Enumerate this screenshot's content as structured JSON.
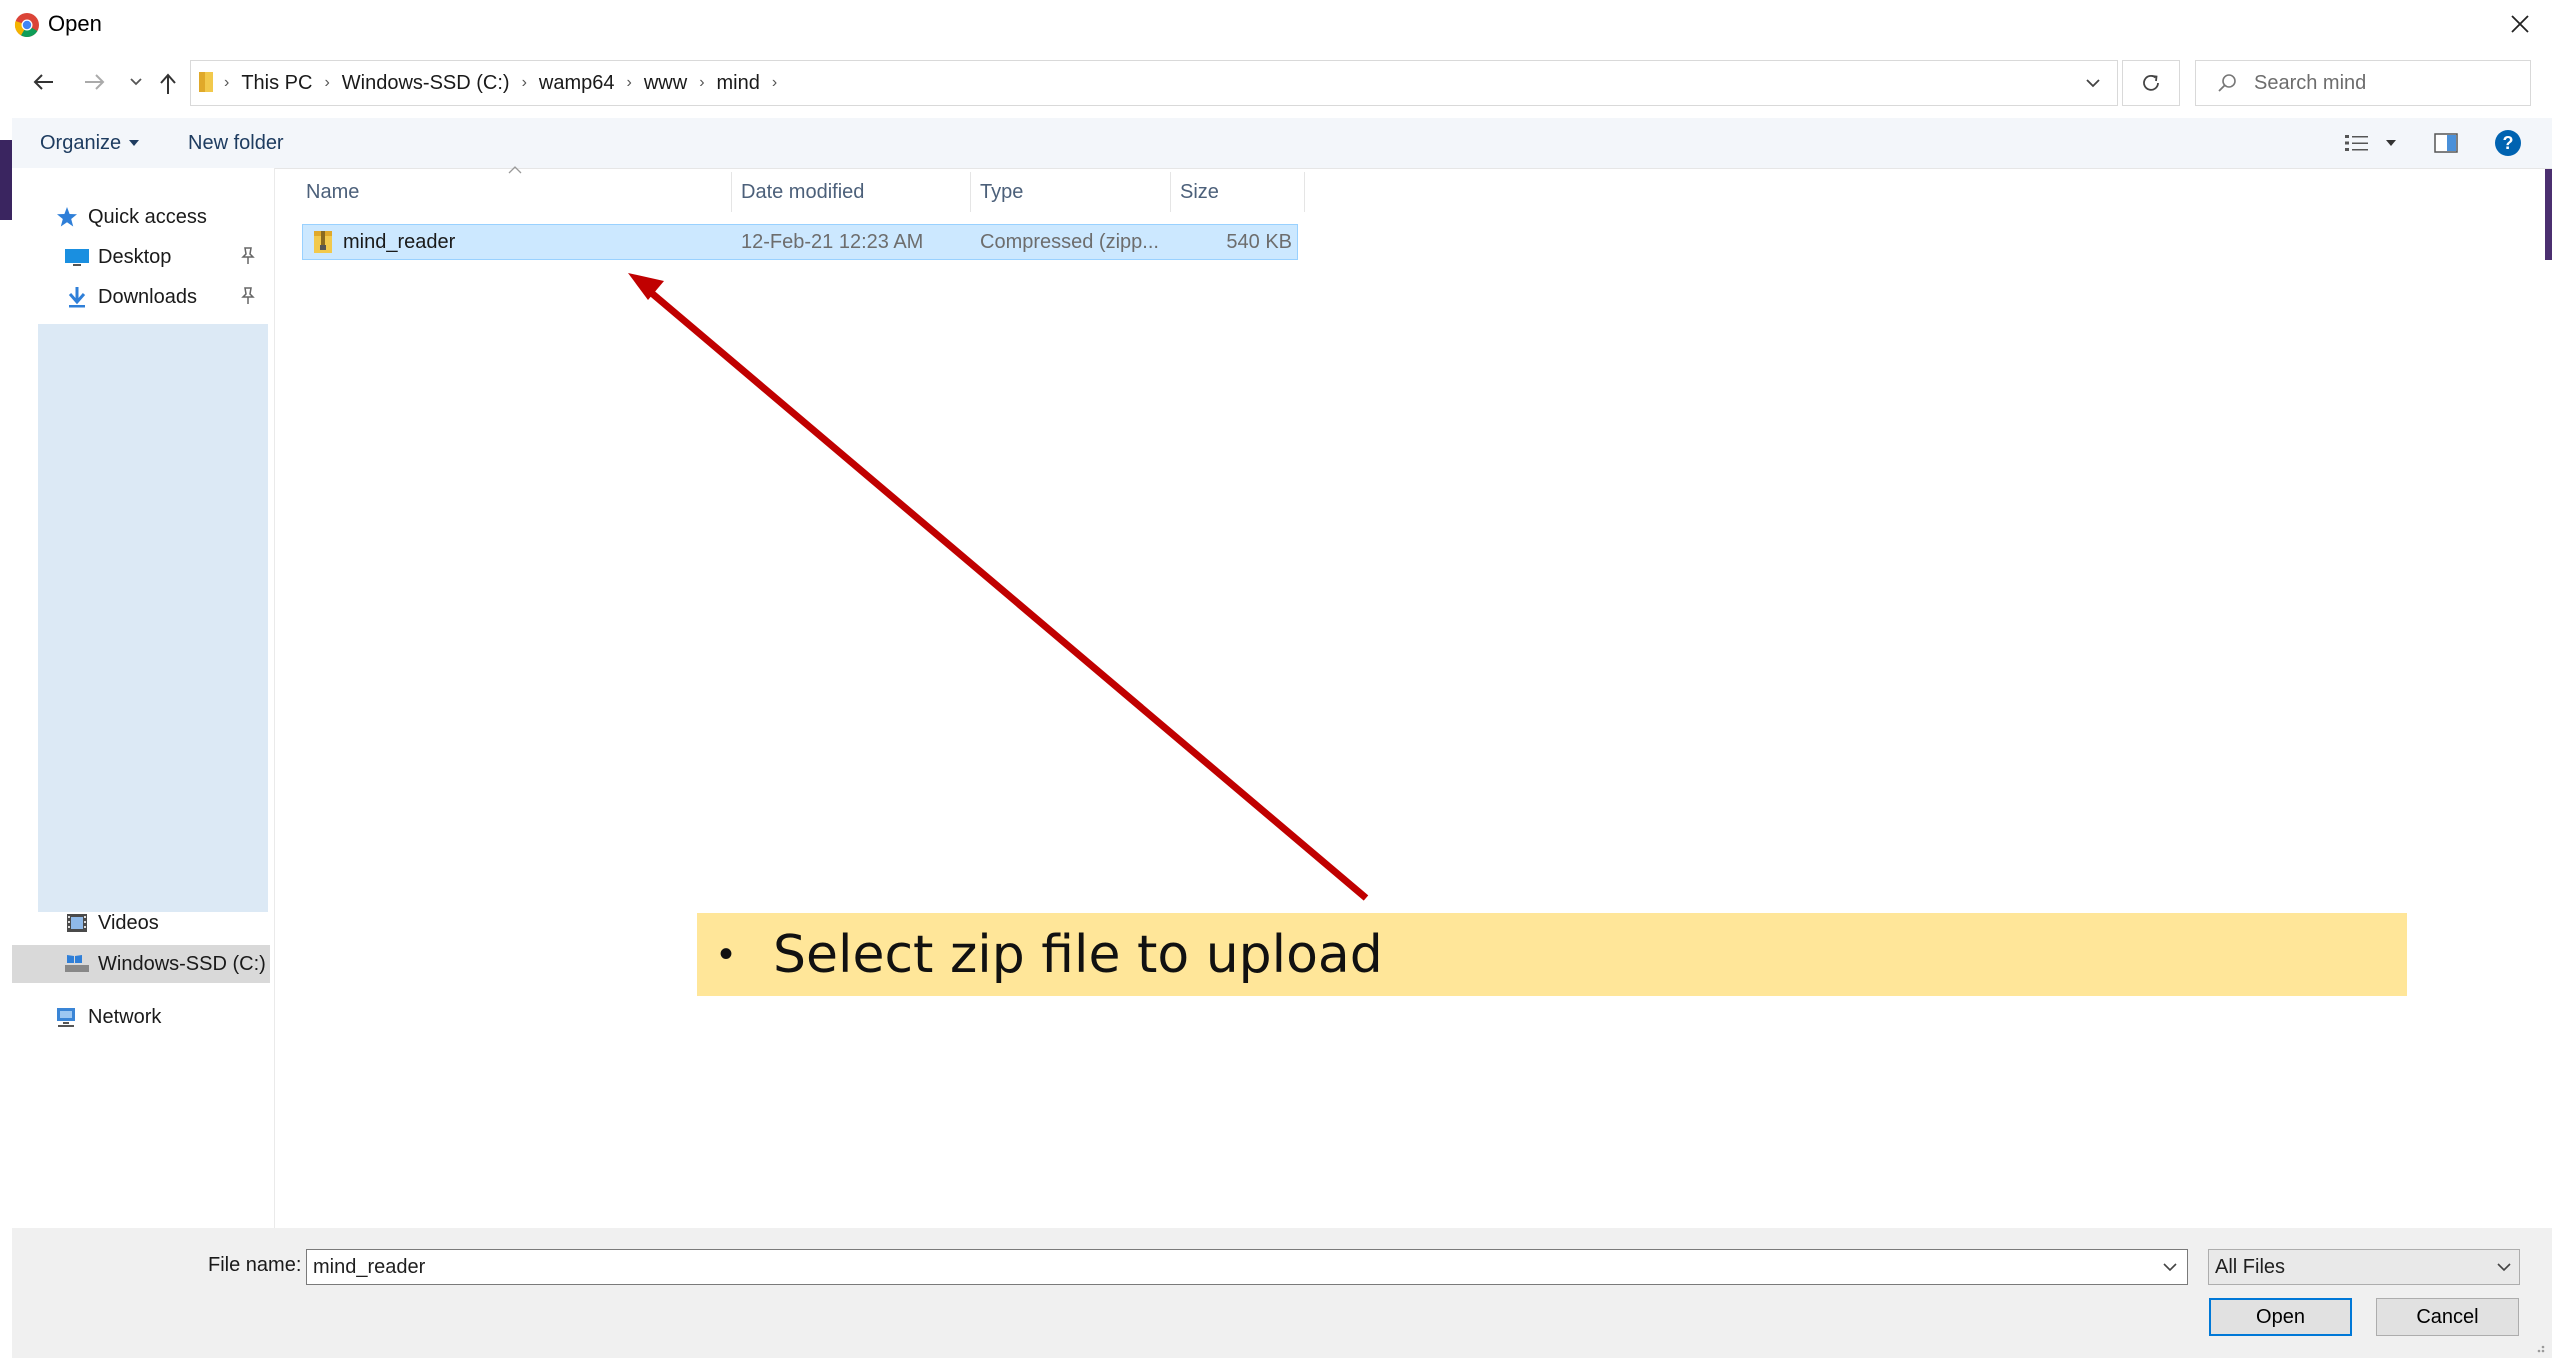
{
  "window": {
    "title": "Open",
    "app_icon": "chrome-icon",
    "close_icon": "close-icon"
  },
  "address": {
    "breadcrumbs": [
      "This PC",
      "Windows-SSD (C:)",
      "wamp64",
      "www",
      "mind"
    ],
    "search_placeholder": "Search mind"
  },
  "toolbar": {
    "organize_label": "Organize",
    "new_folder_label": "New folder"
  },
  "sidebar": {
    "items": [
      {
        "label": "Quick access",
        "icon": "star-icon"
      },
      {
        "label": "Desktop",
        "icon": "desktop-icon",
        "pinned": true
      },
      {
        "label": "Downloads",
        "icon": "download-icon",
        "pinned": true
      },
      {
        "label": "Videos",
        "icon": "video-icon"
      },
      {
        "label": "Windows-SSD (C:)",
        "icon": "drive-icon",
        "selected": true
      },
      {
        "label": "Network",
        "icon": "network-icon"
      }
    ]
  },
  "file_list": {
    "columns": [
      "Name",
      "Date modified",
      "Type",
      "Size"
    ],
    "rows": [
      {
        "name": "mind_reader",
        "date": "12-Feb-21 12:23 AM",
        "type": "Compressed (zipp...",
        "size": "540 KB",
        "selected": true
      }
    ]
  },
  "annotation": {
    "bullet": "•",
    "text": "Select zip file to upload",
    "background": "#ffe699",
    "arrow_color": "#c00000"
  },
  "footer": {
    "file_name_label": "File name:",
    "file_name_value": "mind_reader",
    "file_type_value": "All Files",
    "open_label": "Open",
    "cancel_label": "Cancel"
  },
  "colors": {
    "selection": "#cce8ff",
    "accent": "#0078d7",
    "help": "#0063b1"
  }
}
